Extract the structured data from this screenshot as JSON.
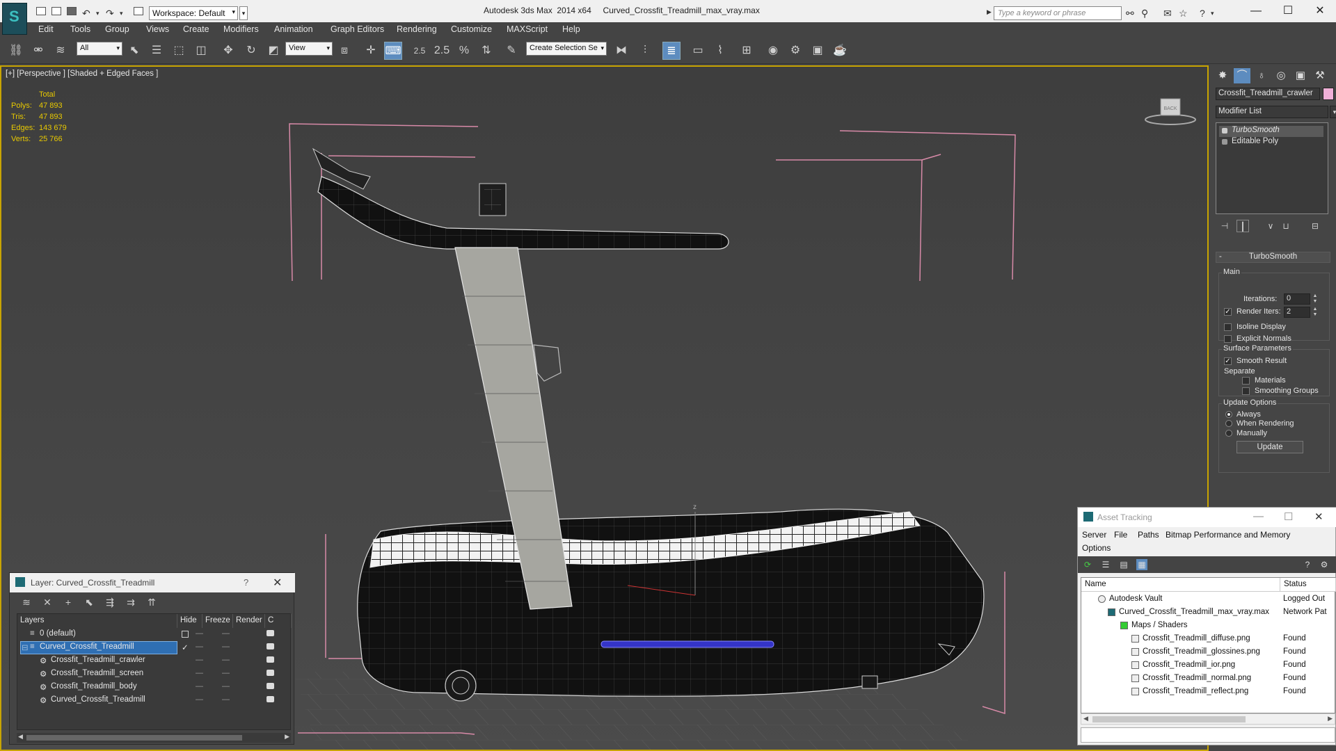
{
  "titlebar": {
    "app_name": "Autodesk 3ds Max  2014 x64",
    "file_name": "Curved_Crossfit_Treadmill_max_vray.max",
    "workspace": "Workspace: Default",
    "search_placeholder": "Type a keyword or phrase"
  },
  "menu": [
    "Edit",
    "Tools",
    "Group",
    "Views",
    "Create",
    "Modifiers",
    "Animation",
    "Graph Editors",
    "Rendering",
    "Customize",
    "MAXScript",
    "Help"
  ],
  "toolbar": {
    "selection_filter": "All",
    "ref_coord": "View",
    "snap_angle": "2.5",
    "named_selection": "Create Selection Se"
  },
  "viewport": {
    "label": "[+] [Perspective ] [Shaded + Edged Faces ]",
    "stats_header": "Total",
    "stats": [
      {
        "k": "Polys:",
        "v": "47 893"
      },
      {
        "k": "Tris:",
        "v": "47 893"
      },
      {
        "k": "Edges:",
        "v": "143 679"
      },
      {
        "k": "Verts:",
        "v": "25 766"
      }
    ],
    "viewcube_label": "BACK",
    "axis_label": "z"
  },
  "command_panel": {
    "object_name": "Crossfit_Treadmill_crawler",
    "object_color": "#f0b0d8",
    "modifier_list": "Modifier List",
    "stack": [
      "TurboSmooth",
      "Editable Poly"
    ],
    "rollout_title": "TurboSmooth",
    "main_group": "Main",
    "iterations_label": "Iterations:",
    "iterations_value": "0",
    "render_iters_label": "Render Iters:",
    "render_iters_value": "2",
    "isoline": "Isoline Display",
    "explicit_normals": "Explicit Normals",
    "surface_group": "Surface Parameters",
    "smooth_result": "Smooth Result",
    "separate": "Separate",
    "materials": "Materials",
    "smoothing_groups": "Smoothing Groups",
    "update_group": "Update Options",
    "always": "Always",
    "when_rendering": "When Rendering",
    "manually": "Manually",
    "update_button": "Update"
  },
  "layer_dialog": {
    "title": "Layer: Curved_Crossfit_Treadmill",
    "help": "?",
    "headers": [
      "Layers",
      "Hide",
      "Freeze",
      "Render",
      "C"
    ],
    "rows": [
      {
        "name": "0 (default)",
        "indent": 0
      },
      {
        "name": "Curved_Crossfit_Treadmill",
        "indent": 0
      },
      {
        "name": "Crossfit_Treadmill_crawler",
        "indent": 1
      },
      {
        "name": "Crossfit_Treadmill_screen",
        "indent": 1
      },
      {
        "name": "Crossfit_Treadmill_body",
        "indent": 1
      },
      {
        "name": "Curved_Crossfit_Treadmill",
        "indent": 1
      }
    ]
  },
  "asset_tracking": {
    "title": "Asset Tracking",
    "menu": [
      "Server",
      "File",
      "Paths",
      "Bitmap Performance and Memory",
      "Options"
    ],
    "headers": [
      "Name",
      "Status"
    ],
    "rows": [
      {
        "name": "Autodesk Vault",
        "status": "Logged Out"
      },
      {
        "name": "Curved_Crossfit_Treadmill_max_vray.max",
        "status": "Network Pat"
      },
      {
        "name": "Maps / Shaders",
        "status": ""
      },
      {
        "name": "Crossfit_Treadmill_diffuse.png",
        "status": "Found"
      },
      {
        "name": "Crossfit_Treadmill_glossines.png",
        "status": "Found"
      },
      {
        "name": "Crossfit_Treadmill_ior.png",
        "status": "Found"
      },
      {
        "name": "Crossfit_Treadmill_normal.png",
        "status": "Found"
      },
      {
        "name": "Crossfit_Treadmill_reflect.png",
        "status": "Found"
      }
    ]
  },
  "colors": {
    "viewport_border": "#c8a400",
    "stats": "#e8c900",
    "selection": "#2f6fb3",
    "bounding_box": "#d88aa8"
  }
}
